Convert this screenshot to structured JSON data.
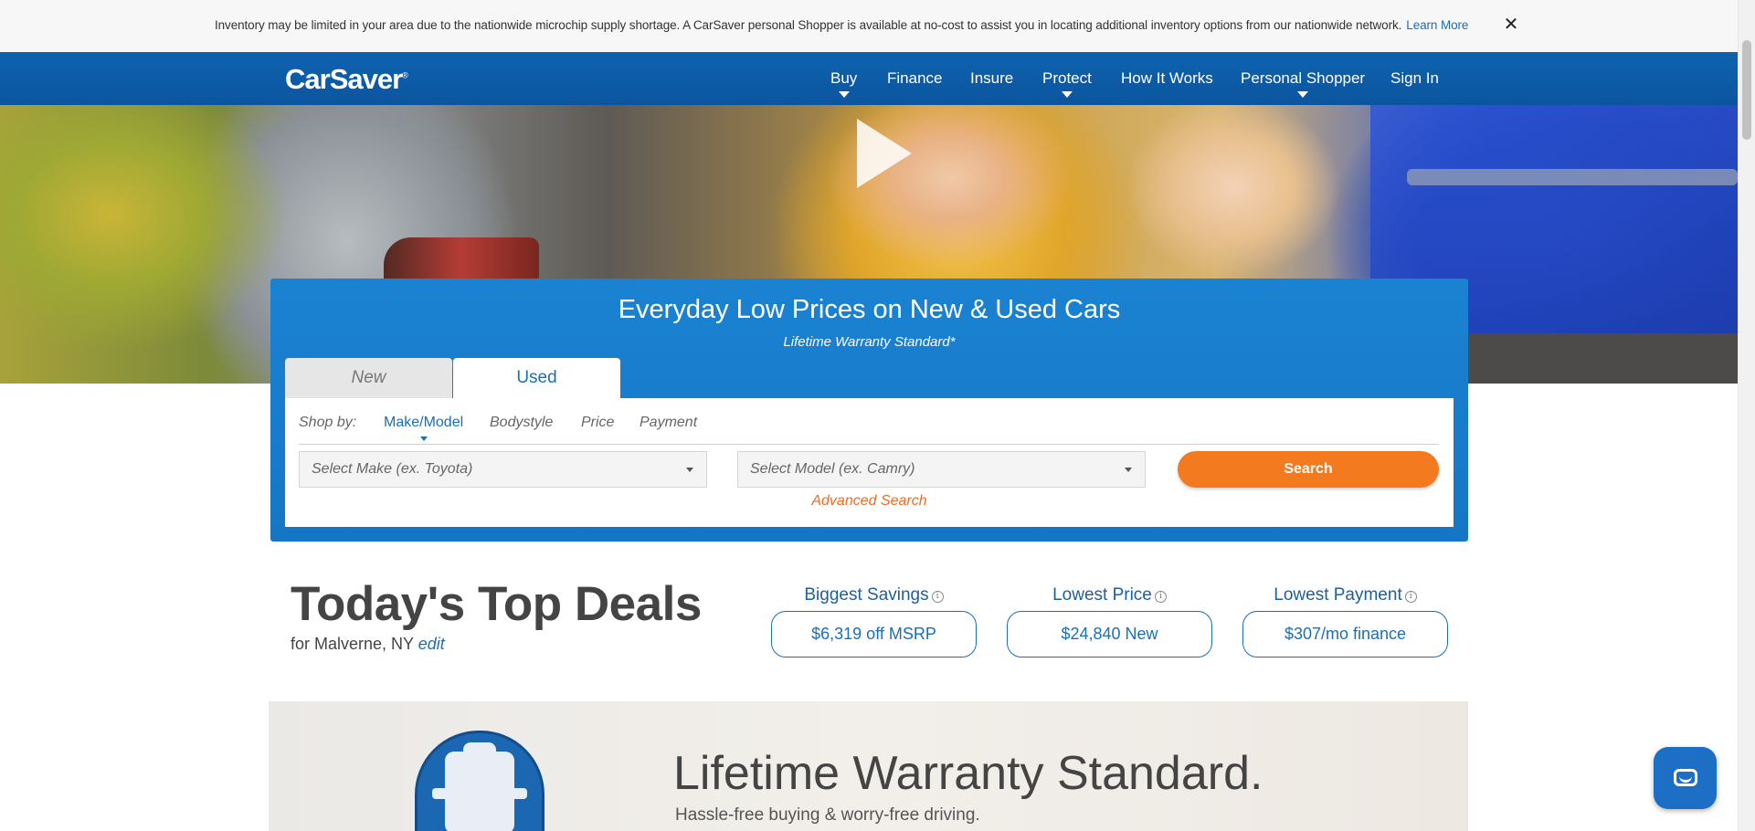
{
  "notice": {
    "text": "Inventory may be limited in your area due to the nationwide microchip supply shortage. A CarSaver personal Shopper is available at no-cost to assist you in locating additional inventory options from our nationwide network.",
    "link": "Learn More",
    "close_icon": "close-icon"
  },
  "header": {
    "logo": "CarSaver",
    "nav": [
      {
        "label": "Buy",
        "dropdown": true
      },
      {
        "label": "Finance",
        "dropdown": false
      },
      {
        "label": "Insure",
        "dropdown": false
      },
      {
        "label": "Protect",
        "dropdown": true
      },
      {
        "label": "How It Works",
        "dropdown": false
      },
      {
        "label": "Personal Shopper",
        "dropdown": true
      },
      {
        "label": "Sign In",
        "dropdown": false
      }
    ]
  },
  "hero": {
    "play_icon": "play-icon"
  },
  "search": {
    "title": "Everyday Low Prices on New & Used Cars",
    "subtitle": "Lifetime Warranty Standard*",
    "tabs": [
      "New",
      "Used"
    ],
    "active_tab": "Used",
    "shop_by_label": "Shop by:",
    "shop_by_options": [
      "Make/Model",
      "Bodystyle",
      "Price",
      "Payment"
    ],
    "active_shop_by": "Make/Model",
    "make_placeholder": "Select Make (ex. Toyota)",
    "model_placeholder": "Select Model (ex. Camry)",
    "search_button": "Search",
    "advanced_search": "Advanced Search"
  },
  "deals": {
    "title": "Today's Top Deals",
    "location_prefix": "for Malverne, NY",
    "edit": "edit",
    "items": [
      {
        "label": "Biggest Savings",
        "value": "$6,319 off MSRP"
      },
      {
        "label": "Lowest Price",
        "value": "$24,840 New"
      },
      {
        "label": "Lowest Payment",
        "value": "$307/mo finance"
      }
    ]
  },
  "warranty": {
    "title": "Lifetime Warranty Standard.",
    "subtitle": "Hassle-free buying & worry-free driving."
  },
  "colors": {
    "brand_blue": "#0e5ca8",
    "panel_blue": "#1a7ccd",
    "search_orange": "#f47a20",
    "link_blue": "#1a6fb5"
  }
}
